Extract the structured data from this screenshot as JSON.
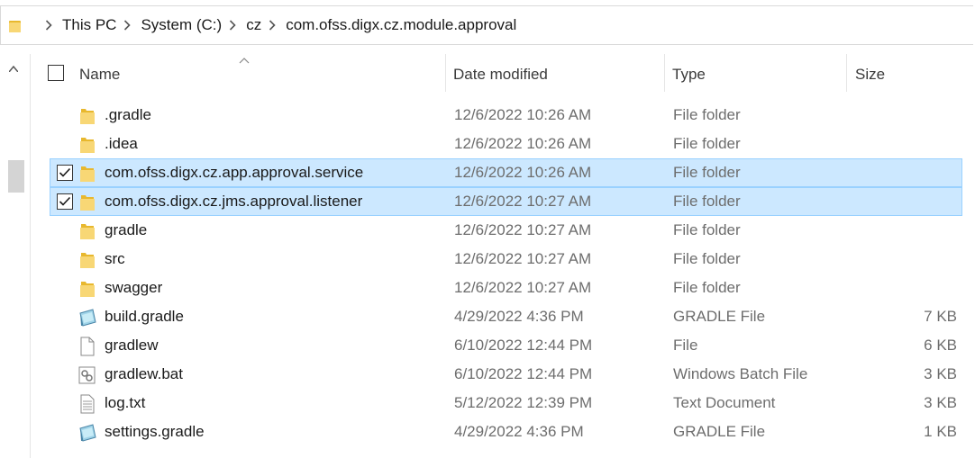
{
  "breadcrumb": {
    "items": [
      "This PC",
      "System (C:)",
      "cz",
      "com.ofss.digx.cz.module.approval"
    ]
  },
  "columns": {
    "name": "Name",
    "date_modified": "Date modified",
    "type": "Type",
    "size": "Size"
  },
  "files": [
    {
      "name": ".gradle",
      "date": "12/6/2022 10:26 AM",
      "type": "File folder",
      "size": "",
      "icon": "folder-icon",
      "selected": false
    },
    {
      "name": ".idea",
      "date": "12/6/2022 10:26 AM",
      "type": "File folder",
      "size": "",
      "icon": "folder-icon",
      "selected": false
    },
    {
      "name": "com.ofss.digx.cz.app.approval.service",
      "date": "12/6/2022 10:26 AM",
      "type": "File folder",
      "size": "",
      "icon": "folder-icon",
      "selected": true
    },
    {
      "name": "com.ofss.digx.cz.jms.approval.listener",
      "date": "12/6/2022 10:27 AM",
      "type": "File folder",
      "size": "",
      "icon": "folder-icon",
      "selected": true
    },
    {
      "name": "gradle",
      "date": "12/6/2022 10:27 AM",
      "type": "File folder",
      "size": "",
      "icon": "folder-icon",
      "selected": false
    },
    {
      "name": "src",
      "date": "12/6/2022 10:27 AM",
      "type": "File folder",
      "size": "",
      "icon": "folder-icon",
      "selected": false
    },
    {
      "name": "swagger",
      "date": "12/6/2022 10:27 AM",
      "type": "File folder",
      "size": "",
      "icon": "folder-icon",
      "selected": false
    },
    {
      "name": "build.gradle",
      "date": "4/29/2022 4:36 PM",
      "type": "GRADLE File",
      "size": "7 KB",
      "icon": "gradle-file-icon",
      "selected": false
    },
    {
      "name": "gradlew",
      "date": "6/10/2022 12:44 PM",
      "type": "File",
      "size": "6 KB",
      "icon": "blank-file-icon",
      "selected": false
    },
    {
      "name": "gradlew.bat",
      "date": "6/10/2022 12:44 PM",
      "type": "Windows Batch File",
      "size": "3 KB",
      "icon": "batch-file-icon",
      "selected": false
    },
    {
      "name": "log.txt",
      "date": "5/12/2022 12:39 PM",
      "type": "Text Document",
      "size": "3 KB",
      "icon": "text-file-icon",
      "selected": false
    },
    {
      "name": "settings.gradle",
      "date": "4/29/2022 4:36 PM",
      "type": "GRADLE File",
      "size": "1 KB",
      "icon": "gradle-file-icon",
      "selected": false
    }
  ],
  "colors": {
    "selection_bg": "#cce8ff",
    "selection_border": "#99d1ff",
    "folder": "#f8d775"
  }
}
